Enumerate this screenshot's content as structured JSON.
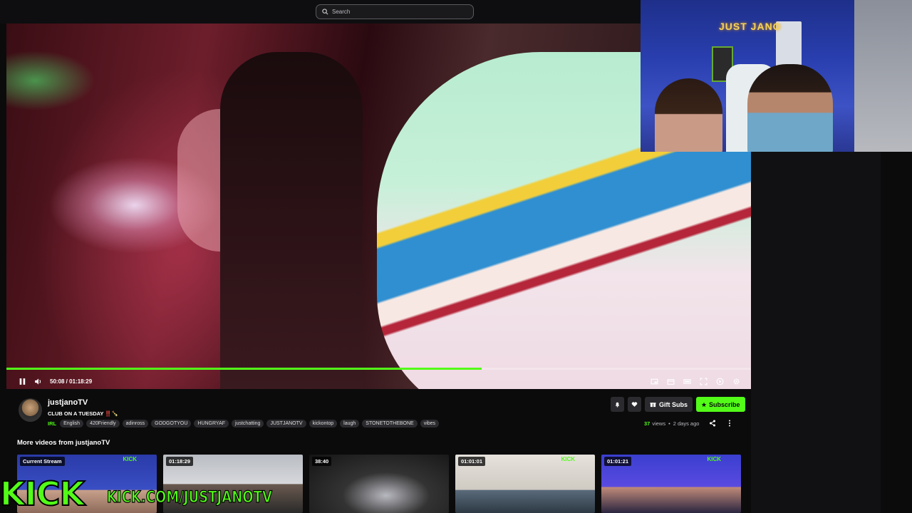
{
  "search": {
    "placeholder": "Search"
  },
  "player": {
    "current_time": "50:08",
    "duration": "01:18:29",
    "time_display": "50:08 / 01:18:29",
    "progress_fraction": 0.638,
    "accent_color": "#53fc18"
  },
  "channel": {
    "name": "justjanoTV",
    "stream_title": "CLUB ON A TUESDAY ‼️🍾",
    "category": "IRL",
    "tags": [
      "English",
      "420Friendly",
      "adinross",
      "GODGOTYOU",
      "HUNGRYAF",
      "justchatting",
      "JUSTJANOTV",
      "kickontop",
      "laugh",
      "STONETOTHEBONE",
      "vibes"
    ]
  },
  "actions": {
    "gift_label": "Gift Subs",
    "subscribe_label": "Subscribe"
  },
  "meta": {
    "views_count": "37",
    "views_label": "views",
    "separator": "•",
    "posted": "2 days ago"
  },
  "more_videos": {
    "title": "More videos from justjanoTV",
    "items": [
      {
        "badge": "Current Stream",
        "kick": "KICK"
      },
      {
        "badge": "01:18:29",
        "kick": ""
      },
      {
        "badge": "38:40",
        "kick": ""
      },
      {
        "badge": "01:01:01",
        "kick": "KICK"
      },
      {
        "badge": "01:01:21",
        "kick": "KICK"
      }
    ]
  },
  "webcam": {
    "sign": "JUST JANO"
  },
  "watermark": {
    "logo": "KICK",
    "url": "KICK.COM/JUSTJANOTV"
  },
  "icons": [
    "search-icon",
    "pause-icon",
    "volume-icon",
    "miniplayer-icon",
    "theater-icon",
    "captions-icon",
    "fullscreen-icon",
    "speed-icon",
    "settings-icon",
    "bell-icon",
    "heart-icon",
    "gift-icon",
    "share-icon",
    "more-icon"
  ]
}
